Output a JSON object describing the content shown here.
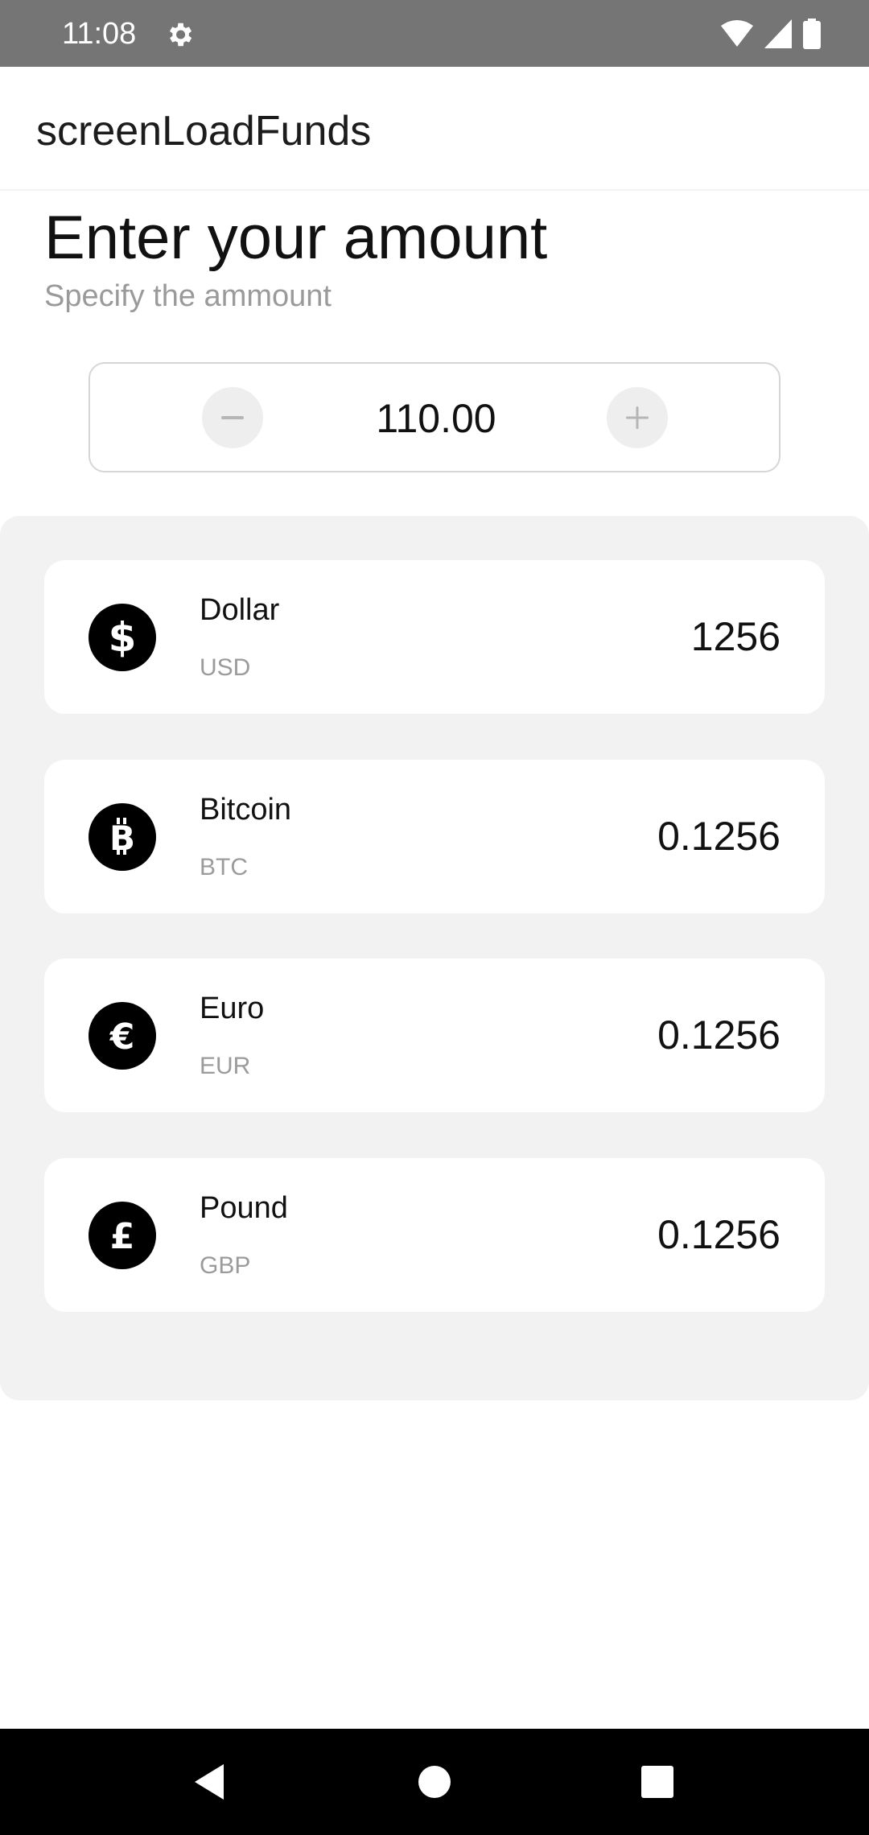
{
  "status_bar": {
    "time": "11:08"
  },
  "app_bar": {
    "title": "screenLoadFunds"
  },
  "heading": {
    "title": "Enter your amount",
    "subtitle": "Specify the ammount"
  },
  "stepper": {
    "value": "110.00"
  },
  "currencies": [
    {
      "name": "Dollar",
      "code": "USD",
      "amount": "1256",
      "icon": "dollar-icon"
    },
    {
      "name": "Bitcoin",
      "code": "BTC",
      "amount": "0.1256",
      "icon": "bitcoin-icon"
    },
    {
      "name": "Euro",
      "code": "EUR",
      "amount": "0.1256",
      "icon": "euro-icon"
    },
    {
      "name": "Pound",
      "code": "GBP",
      "amount": "0.1256",
      "icon": "pound-icon"
    }
  ],
  "colors": {
    "status_bar": "#757575",
    "panel": "#f2f2f2",
    "card": "#ffffff",
    "icon_bg": "#000000",
    "muted_text": "#9b9b9b"
  }
}
